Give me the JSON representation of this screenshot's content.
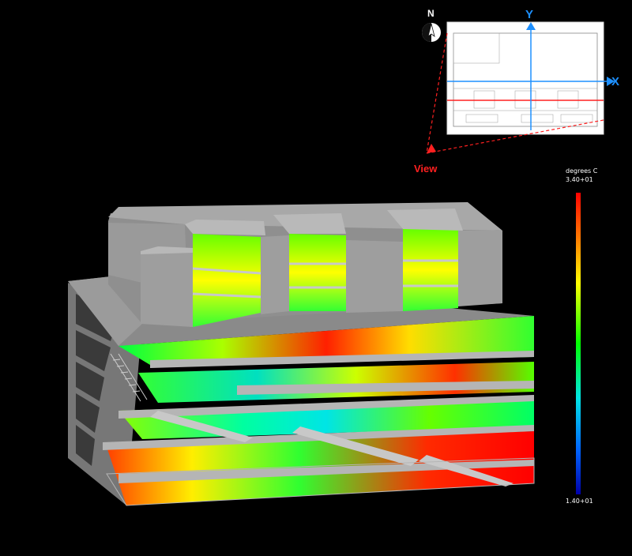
{
  "legend": {
    "title": "degrees C",
    "max_label": "3.40+01",
    "min_label": "1.40+01",
    "max_value": 34,
    "min_value": 14,
    "colors": [
      "#ff0000",
      "#ff7a00",
      "#ffff00",
      "#00ff00",
      "#00e5e5",
      "#0066ff",
      "#0000aa"
    ]
  },
  "key_plan": {
    "north_label": "N",
    "view_label": "View",
    "y_axis_label": "Y",
    "x_axis_label": "X",
    "axis_color": "#1e90ff",
    "section_line_color": "#ff2020"
  },
  "colors": {
    "background": "#000000",
    "building_gray": "#a9a9a9",
    "building_dark": "#7d7d7d",
    "slab_light": "#c8c8c8"
  }
}
